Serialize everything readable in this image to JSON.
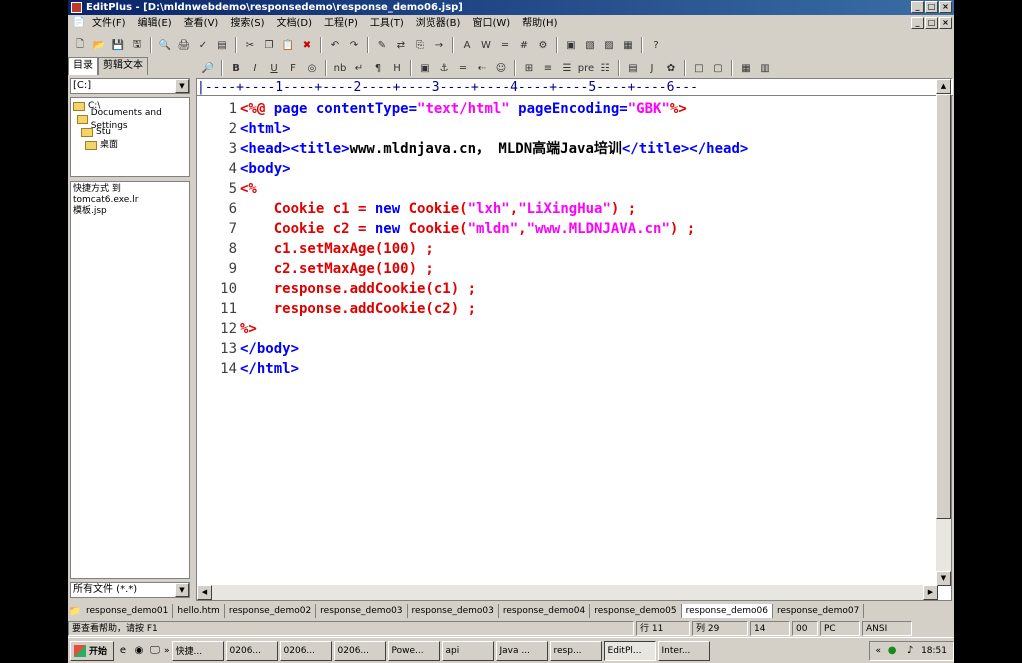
{
  "window": {
    "title": "EditPlus - [D:\\mldnwebdemo\\responsedemo\\response_demo06.jsp]"
  },
  "caption_buttons": [
    "_",
    "□",
    "×"
  ],
  "menu": [
    "文件(F)",
    "编辑(E)",
    "查看(V)",
    "搜索(S)",
    "文档(D)",
    "工程(P)",
    "工具(T)",
    "浏览器(B)",
    "窗口(W)",
    "帮助(H)"
  ],
  "toolbar2_labels": [
    "B",
    "I",
    "U",
    "F",
    "nb",
    "¶",
    "H",
    "J"
  ],
  "left_panel": {
    "tabs": [
      "目录",
      "剪辑文本"
    ],
    "drive": "[C:]",
    "dirs": [
      "C:\\",
      "Documents and Settings",
      "Stu",
      "桌面"
    ],
    "files": [
      "快捷方式 到 tomcat6.exe.lr",
      "模板.jsp"
    ],
    "filter": "所有文件 (*.*)"
  },
  "editor": {
    "ruler": "|----+----1----+----2----+----3----+----4----+----5----+----6---",
    "line_numbers": [
      "1",
      "2",
      "3",
      "4",
      "5",
      "6",
      "7",
      "8",
      "9",
      "10",
      "11",
      "12",
      "13",
      "14"
    ]
  },
  "code": {
    "l1": {
      "a": "<%@ ",
      "b": "page contentType=",
      "c": "\"text/html\"",
      "d": " pageEncoding=",
      "e": "\"GBK\"",
      "f": "%>"
    },
    "l2": "<html>",
    "l3": {
      "a": "<head><title>",
      "b": "www.mldnjava.cn， MLDN高端Java培训",
      "c": "</title></head>"
    },
    "l4": "<body>",
    "l5": "<%",
    "l6": {
      "a": "    Cookie c1 = ",
      "b": "new",
      "c": " Cookie(",
      "d": "\"lxh\"",
      "e": ",",
      "f": "\"LiXingHua\"",
      "g": ") ;"
    },
    "l7": {
      "a": "    Cookie c2 = ",
      "b": "new",
      "c": " Cookie(",
      "d": "\"mldn\"",
      "e": ",",
      "f": "\"www.MLDNJAVA.cn\"",
      "g": ") ;"
    },
    "l8": "    c1.setMaxAge(100) ;",
    "l9": "    c2.setMaxAge(100) ;",
    "l10": "    response.addCookie(c1) ;",
    "l11": "    response.addCookie(c2) ;",
    "l12": "%>",
    "l13": "</body>",
    "l14": "</html>"
  },
  "doc_tabs": [
    "response_demo01",
    "hello.htm",
    "response_demo02",
    "response_demo03",
    "response_demo03",
    "response_demo04",
    "response_demo05",
    "response_demo06",
    "response_demo07"
  ],
  "status": {
    "help": "要查看帮助，请按 F1",
    "row": "行 11",
    "col": "列 29",
    "num": "14",
    "ovr": "00",
    "mode": "PC",
    "enc": "ANSI"
  },
  "taskbar": {
    "start": "开始",
    "items": [
      "快捷...",
      "0206...",
      "0206...",
      "0206...",
      "Powe...",
      "api",
      "Java ...",
      "resp...",
      "EditPl...",
      "Inter..."
    ],
    "chevron": "»",
    "tray_chevron": "«",
    "clock": "18:51"
  }
}
